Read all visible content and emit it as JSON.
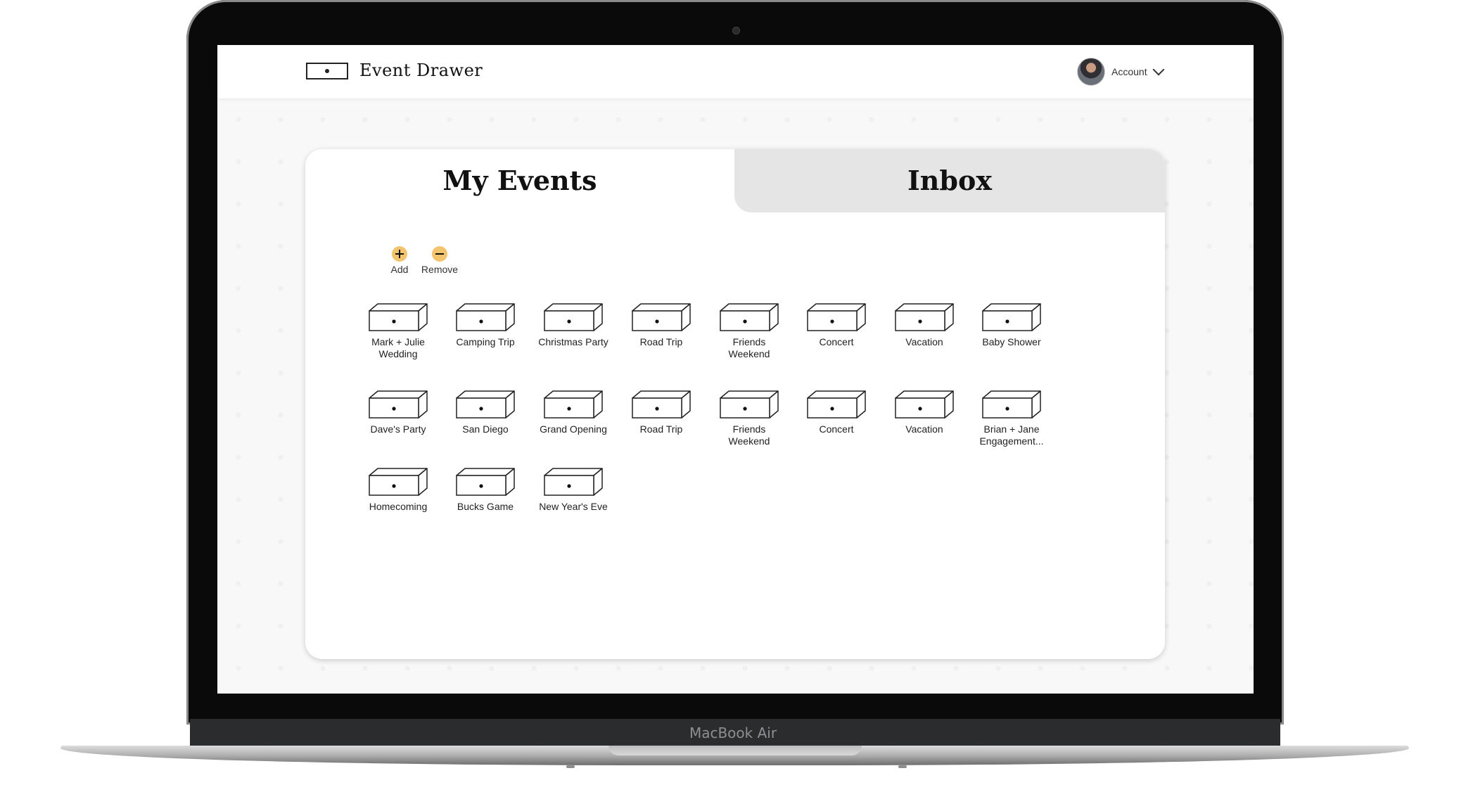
{
  "app": {
    "name": "Event Drawer"
  },
  "account": {
    "label": "Account"
  },
  "tabs": {
    "my_events": "My Events",
    "inbox": "Inbox"
  },
  "actions": {
    "add": "Add",
    "remove": "Remove"
  },
  "events": [
    "Mark + Julie Wedding",
    "Camping Trip",
    "Christmas Party",
    "Road Trip",
    "Friends Weekend",
    "Concert",
    "Vacation",
    "Baby Shower",
    "Dave's Party",
    "San Diego",
    "Grand Opening",
    "Road Trip",
    "Friends Weekend",
    "Concert",
    "Vacation",
    "Brian + Jane Engagement...",
    "Homecoming",
    "Bucks Game",
    "New Year's Eve"
  ],
  "device": {
    "brand": "MacBook Air"
  },
  "colors": {
    "action_accent": "#f2c46d",
    "inbox_tab": "#e5e5e5"
  }
}
